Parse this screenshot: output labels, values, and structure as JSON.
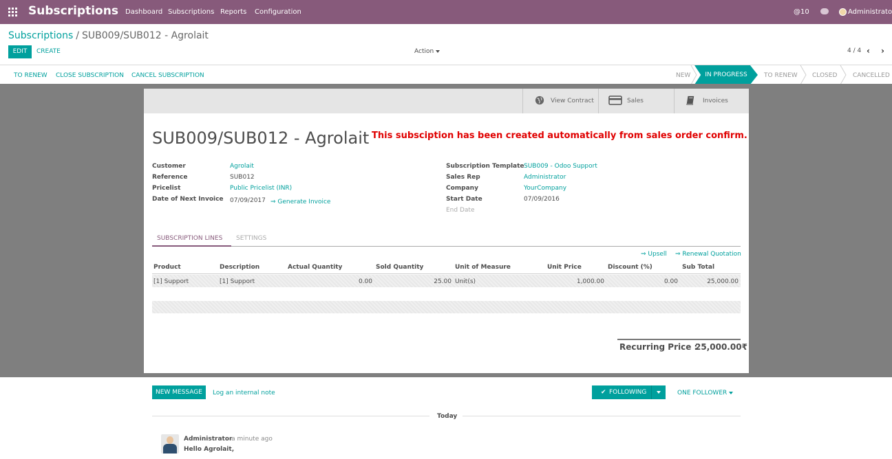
{
  "topbar": {
    "brand": "Subscriptions",
    "menu": [
      "Dashboard",
      "Subscriptions",
      "Reports",
      "Configuration"
    ],
    "mentions": "@10",
    "user": "Administrator",
    "color": "#875a7b"
  },
  "control": {
    "breadcrumb_parent": "Subscriptions",
    "breadcrumb_sep": "/",
    "breadcrumb_current": "SUB009/SUB012 - Agrolait",
    "edit": "EDIT",
    "create": "CREATE",
    "action": "Action",
    "pager": "4 / 4"
  },
  "statusbar": {
    "buttons": [
      "TO RENEW",
      "CLOSE SUBSCRIPTION",
      "CANCEL SUBSCRIPTION"
    ],
    "stages": [
      "NEW",
      "IN PROGRESS",
      "TO RENEW",
      "CLOSED",
      "CANCELLED"
    ],
    "active_stage": "IN PROGRESS",
    "accent": "#00a09d"
  },
  "smart_buttons": {
    "contract": "View Contract",
    "sales": "Sales",
    "invoices": "Invoices"
  },
  "record": {
    "title": "SUB009/SUB012 - Agrolait",
    "notice": "This subsciption has been created automatically from sales order confirm.",
    "left": {
      "customer_label": "Customer",
      "customer": "Agrolait",
      "reference_label": "Reference",
      "reference": "SUB012",
      "pricelist_label": "Pricelist",
      "pricelist": "Public Pricelist (INR)",
      "next_invoice_label": "Date of Next Invoice",
      "next_invoice": "07/09/2017",
      "generate": "⇒ Generate Invoice"
    },
    "right": {
      "template_label": "Subscription Template",
      "template": "SUB009 - Odoo Support",
      "rep_label": "Sales Rep",
      "rep": "Administrator",
      "company_label": "Company",
      "company": "YourCompany",
      "start_label": "Start Date",
      "start": "07/09/2016",
      "end_placeholder": "End Date"
    }
  },
  "tabs": [
    "SUBSCRIPTION LINES",
    "SETTINGS"
  ],
  "lines": {
    "upsell": "⇒ Upsell",
    "renewal": "⇒ Renewal Quotation",
    "headers": [
      "Product",
      "Description",
      "Actual Quantity",
      "Sold Quantity",
      "Unit of Measure",
      "Unit Price",
      "Discount (%)",
      "Sub Total"
    ],
    "rows": [
      [
        "[1] Support",
        "[1] Support",
        "0.00",
        "25.00",
        "Unit(s)",
        "1,000.00",
        "0.00",
        "25,000.00"
      ]
    ]
  },
  "total": {
    "label": "Recurring Price :",
    "value": "25,000.00₹"
  },
  "chatter": {
    "new_message": "NEW MESSAGE",
    "log_note": "Log an internal note",
    "following": "FOLLOWING",
    "followers": "ONE FOLLOWER",
    "today": "Today",
    "author": "Administrator",
    "time": "- a minute ago",
    "body": "Hello Agrolait,"
  }
}
